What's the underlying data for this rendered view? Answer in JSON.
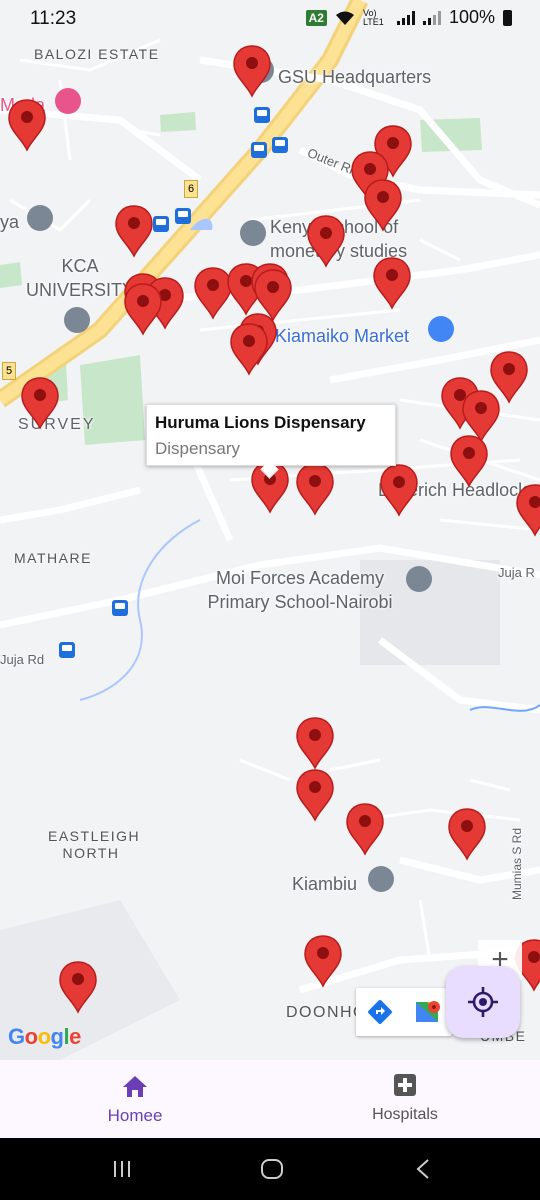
{
  "status_bar": {
    "time": "11:23",
    "road_badge": "A2",
    "network": "Vo) LTE1",
    "battery": "100%"
  },
  "map": {
    "place_labels": {
      "gsu": "GSU Headquarters",
      "mada": "Mada",
      "kenya_school": "Kenya school of monetary studies",
      "kca": "KCA UNIVERSITY",
      "kiamaiko": "Kiamaiko Market",
      "moi_forces": "Moi Forces Academy Primary School-Nairobi",
      "kiambiu": "Kiambiu",
      "outer_ring": "Outer Ring Rd",
      "juja_rd_left": "Juja Rd",
      "juja_rd_right": "Juja R",
      "headlock": "Lunerich Headlock",
      "survey": "SURVEY",
      "ya": "ya",
      "mumias": "Mumias S Rd"
    },
    "area_labels": {
      "balozi": "BALOZI ESTATE",
      "mathare": "MATHARE",
      "eastleigh": "EASTLEIGH NORTH",
      "doonholm": "DOONHOLM",
      "umbe": "UMBE"
    },
    "road_numbers": [
      "6",
      "5"
    ],
    "pin_color": "#e53935",
    "attribution": "Google"
  },
  "info_window": {
    "title": "Huruma Lions Dispensary",
    "subtitle": "Dispensary"
  },
  "fab_icon": "my-location-icon",
  "bottom_nav": {
    "home_label": "Homee",
    "hospitals_label": "Hospitals",
    "active_color": "#6a3fb5"
  }
}
